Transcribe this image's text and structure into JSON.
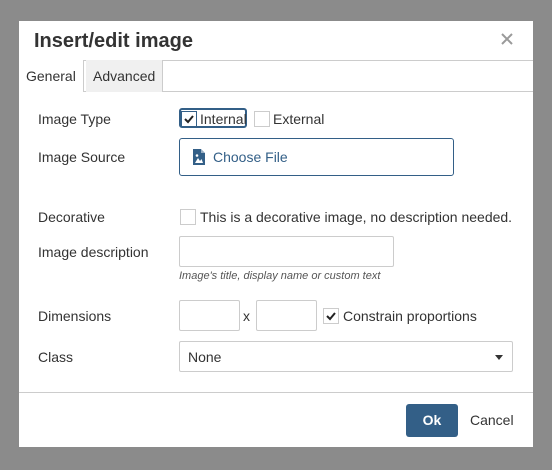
{
  "dialog": {
    "title": "Insert/edit image"
  },
  "tabs": [
    {
      "label": "General",
      "active": true
    },
    {
      "label": "Advanced",
      "active": false
    }
  ],
  "form": {
    "image_type": {
      "label": "Image Type",
      "options": [
        {
          "label": "Internal",
          "checked": true
        },
        {
          "label": "External",
          "checked": false
        }
      ]
    },
    "image_source": {
      "label": "Image Source",
      "button_label": "Choose File"
    },
    "decorative": {
      "label": "Decorative",
      "checkbox_label": "This is a decorative image, no description needed.",
      "checked": false
    },
    "image_description": {
      "label": "Image description",
      "value": "",
      "hint": "Image's title, display name or custom text"
    },
    "dimensions": {
      "label": "Dimensions",
      "width": "",
      "height": "",
      "separator": "x",
      "constrain_label": "Constrain proportions",
      "constrain_checked": true
    },
    "class": {
      "label": "Class",
      "selected": "None"
    }
  },
  "footer": {
    "ok_label": "Ok",
    "cancel_label": "Cancel"
  },
  "colors": {
    "accent": "#335f87",
    "backdrop": "#8b8b8b"
  }
}
